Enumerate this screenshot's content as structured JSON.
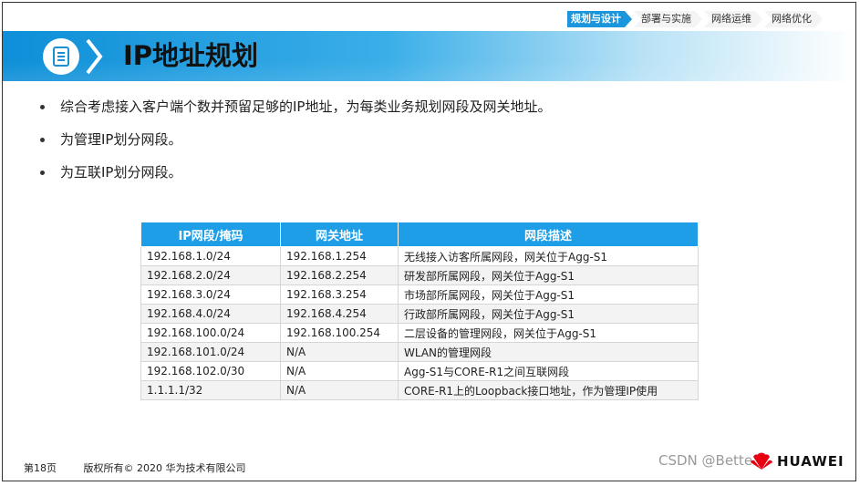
{
  "breadcrumb": [
    "规划与设计",
    "部署与实施",
    "网络运维",
    "网络优化"
  ],
  "title": "IP地址规划",
  "bullets": [
    "综合考虑接入客户端个数并预留足够的IP地址，为每类业务规划网段及网关地址。",
    "为管理IP划分网段。",
    "为互联IP划分网段。"
  ],
  "table": {
    "headers": [
      "IP网段/掩码",
      "网关地址",
      "网段描述"
    ],
    "rows": [
      [
        "192.168.1.0/24",
        "192.168.1.254",
        "无线接入访客所属网段，网关位于Agg-S1"
      ],
      [
        "192.168.2.0/24",
        "192.168.2.254",
        "研发部所属网段，网关位于Agg-S1"
      ],
      [
        "192.168.3.0/24",
        "192.168.3.254",
        "市场部所属网段，网关位于Agg-S1"
      ],
      [
        "192.168.4.0/24",
        "192.168.4.254",
        "行政部所属网段，网关位于Agg-S1"
      ],
      [
        "192.168.100.0/24",
        "192.168.100.254",
        "二层设备的管理网段，网关位于Agg-S1"
      ],
      [
        "192.168.101.0/24",
        "N/A",
        "WLAN的管理网段"
      ],
      [
        "192.168.102.0/30",
        "N/A",
        "Agg-S1与CORE-R1之间互联网段"
      ],
      [
        "1.1.1.1/32",
        "N/A",
        "CORE-R1上的Loopback接口地址，作为管理IP使用"
      ]
    ]
  },
  "footer": {
    "page": "第18页",
    "copyright": "版权所有© 2020 华为技术有限公司",
    "watermark": "CSDN @Bette",
    "brand": "HUAWEI"
  },
  "colors": {
    "accent": "#1e9ee6",
    "banner": "#0e8fd8",
    "logo_red": "#e60012"
  },
  "icons": {
    "title": "document-icon",
    "logo": "huawei-logo-icon"
  }
}
